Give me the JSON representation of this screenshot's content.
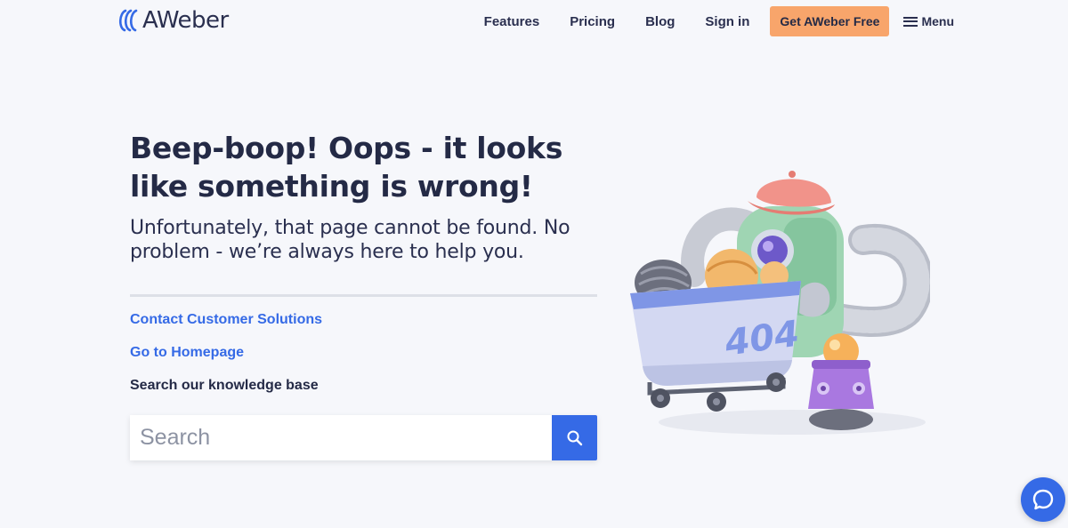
{
  "header": {
    "logo_text": "AWeber",
    "nav": [
      "Features",
      "Pricing",
      "Blog",
      "Sign in"
    ],
    "cta_label": "Get AWeber Free",
    "menu_label": "Menu"
  },
  "main": {
    "headline": "Beep-boop! Oops - it looks like something is wrong!",
    "subhead": "Unfortunately, that page cannot be found. No problem - we’re always here to help you.",
    "links": [
      "Contact Customer Solutions",
      "Go to Homepage"
    ],
    "kb_label": "Search our knowledge base",
    "search_placeholder": "Search"
  },
  "illustration": {
    "cart_label": "404"
  },
  "colors": {
    "accent": "#356ae6",
    "cta": "#f8a56b",
    "background": "#f6f7fb",
    "text": "#242a46"
  },
  "icons": [
    "aweber-logo-icon",
    "hamburger-icon",
    "search-icon",
    "chat-icon"
  ]
}
